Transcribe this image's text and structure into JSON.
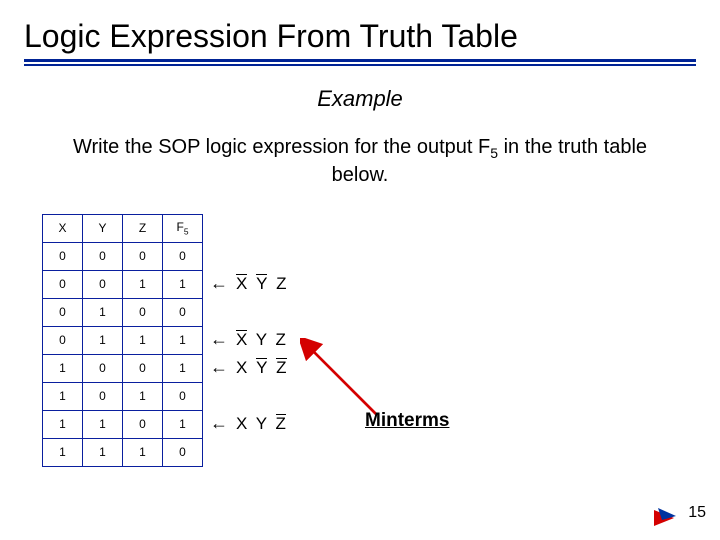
{
  "title": "Logic Expression From Truth Table",
  "example_label": "Example",
  "prompt_pre": "Write the SOP logic expression for the output F",
  "prompt_sub": "5",
  "prompt_post": " in the truth table below.",
  "headers": {
    "c0": "X",
    "c1": "Y",
    "c2": "Z",
    "c3_pre": "F",
    "c3_sub": "5"
  },
  "rows": [
    {
      "x": "0",
      "y": "0",
      "z": "0",
      "f": "0",
      "minterm": null
    },
    {
      "x": "0",
      "y": "0",
      "z": "1",
      "f": "1",
      "minterm": [
        "Xb",
        "Yb",
        "Z"
      ]
    },
    {
      "x": "0",
      "y": "1",
      "z": "0",
      "f": "0",
      "minterm": null
    },
    {
      "x": "0",
      "y": "1",
      "z": "1",
      "f": "1",
      "minterm": [
        "Xb",
        "Y",
        "Z"
      ]
    },
    {
      "x": "1",
      "y": "0",
      "z": "0",
      "f": "1",
      "minterm": [
        "X",
        "Yb",
        "Zb"
      ]
    },
    {
      "x": "1",
      "y": "0",
      "z": "1",
      "f": "0",
      "minterm": null
    },
    {
      "x": "1",
      "y": "1",
      "z": "0",
      "f": "1",
      "minterm": [
        "X",
        "Y",
        "Zb"
      ]
    },
    {
      "x": "1",
      "y": "1",
      "z": "1",
      "f": "0",
      "minterm": null
    }
  ],
  "arrow_left": "←",
  "minterms_label": "Minterms",
  "page_number": "15"
}
